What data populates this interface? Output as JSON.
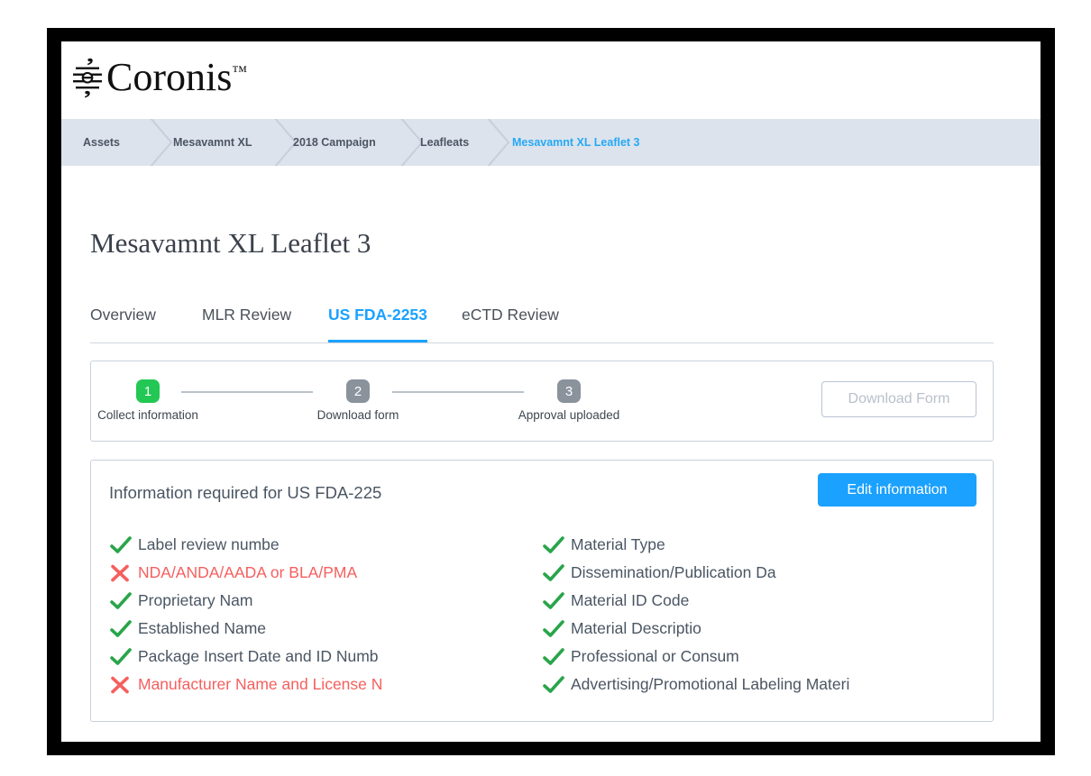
{
  "brand": {
    "name": "Coronis",
    "trademark": "™",
    "logo_icon": "coronis-glyph-icon"
  },
  "colors": {
    "accent_blue": "#1ba1ff",
    "breadcrumb_bg": "#dce3ec",
    "step_done_green": "#22c853",
    "step_pending_gray": "#8a929c",
    "error_red": "#f4605f",
    "check_green": "#2aa54a",
    "text_dark": "#4a5663",
    "frame_black": "#000000"
  },
  "breadcrumb": {
    "items": [
      {
        "label": "Assets",
        "current": false
      },
      {
        "label": "Mesavamnt XL",
        "current": false
      },
      {
        "label": "2018 Campaign",
        "current": false
      },
      {
        "label": "Leafleats",
        "current": false
      },
      {
        "label": "Mesavamnt XL Leaflet 3",
        "current": true
      }
    ]
  },
  "page": {
    "title": "Mesavamnt XL Leaflet 3"
  },
  "tabs": [
    {
      "label": "Overview",
      "active": false
    },
    {
      "label": "MLR Review",
      "active": false
    },
    {
      "label": "US FDA-2253",
      "active": true
    },
    {
      "label": "eCTD Review",
      "active": false
    }
  ],
  "stepper": {
    "steps": [
      {
        "number": "1",
        "label": "Collect information",
        "state": "active"
      },
      {
        "number": "2",
        "label": "Download form",
        "state": "pending"
      },
      {
        "number": "3",
        "label": "Approval uploaded",
        "state": "pending"
      }
    ],
    "download_button": {
      "label": "Download Form",
      "disabled": true
    }
  },
  "info_panel": {
    "title": "Information required for US FDA-225",
    "edit_button_label": "Edit information",
    "left_column": [
      {
        "label": "Label review numbe",
        "status": "complete",
        "icon": "check-icon"
      },
      {
        "label": "NDA/ANDA/AADA or BLA/PMA",
        "status": "missing",
        "icon": "cross-icon"
      },
      {
        "label": "Proprietary Nam",
        "status": "complete",
        "icon": "check-icon"
      },
      {
        "label": "Established Name",
        "status": "complete",
        "icon": "check-icon"
      },
      {
        "label": "Package Insert Date and ID Numb",
        "status": "complete",
        "icon": "check-icon"
      },
      {
        "label": "Manufacturer Name and License N",
        "status": "missing",
        "icon": "cross-icon"
      }
    ],
    "right_column": [
      {
        "label": "Material Type",
        "status": "complete",
        "icon": "check-icon"
      },
      {
        "label": "Dissemination/Publication Da",
        "status": "complete",
        "icon": "check-icon"
      },
      {
        "label": "Material ID Code",
        "status": "complete",
        "icon": "check-icon"
      },
      {
        "label": "Material Descriptio",
        "status": "complete",
        "icon": "check-icon"
      },
      {
        "label": "Professional or Consum",
        "status": "complete",
        "icon": "check-icon"
      },
      {
        "label": "Advertising/Promotional Labeling Materi",
        "status": "complete",
        "icon": "check-icon"
      }
    ]
  }
}
